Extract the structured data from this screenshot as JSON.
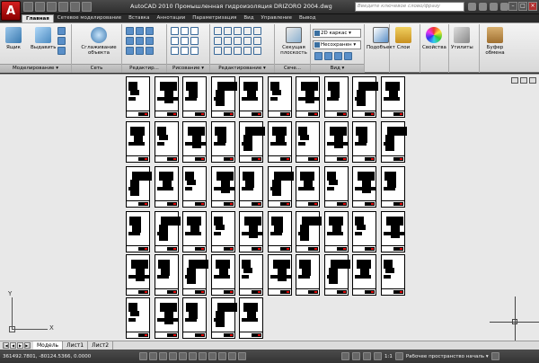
{
  "app": {
    "logo": "A",
    "title": "AutoCAD 2010     Промышленная гидроизоляция DRIZORO 2004.dwg",
    "search_placeholder": "Введите ключевое слово/фразу"
  },
  "ribbon_tabs": [
    {
      "label": "Главная",
      "active": true
    },
    {
      "label": "Сетевое моделирование"
    },
    {
      "label": "Вставка"
    },
    {
      "label": "Аннотации"
    },
    {
      "label": "Параметризация"
    },
    {
      "label": "Вид"
    },
    {
      "label": "Управление"
    },
    {
      "label": "Вывод"
    }
  ],
  "ribbon": {
    "modeling": {
      "footer": "Моделирование ▾",
      "box": "Ящик",
      "extrude": "Выдавить"
    },
    "mesh": {
      "footer": "Сеть",
      "smooth": "Сглаживание объекта"
    },
    "edit": {
      "footer": "Редактир..."
    },
    "draw": {
      "footer": "Рисование ▾"
    },
    "modify": {
      "footer": "Редактирование ▾"
    },
    "section": {
      "footer": "Сече...",
      "plane": "Секущая плоскость"
    },
    "view": {
      "footer": "Вид ▾",
      "visual_style": "2D каркас",
      "unsaved": "Несохранен"
    },
    "subobject": {
      "label": "Подобъект"
    },
    "layers": {
      "label": "Слои"
    },
    "properties": {
      "label": "Свойства"
    },
    "utilities": {
      "label": "Утилиты"
    },
    "clipboard": {
      "label": "Буфер обмена"
    }
  },
  "ucs": {
    "x": "X",
    "y": "Y"
  },
  "layout_tabs": [
    {
      "label": "Модель",
      "active": true
    },
    {
      "label": "Лист1"
    },
    {
      "label": "Лист2"
    }
  ],
  "status": {
    "coords": "361492.7801, -80124.5366, 0.0000",
    "scale": "1:1",
    "workspace": "Рабочее пространство началь ▾"
  },
  "colors": {
    "accent_red": "#d42020",
    "canvas": "#e8e8e8"
  }
}
